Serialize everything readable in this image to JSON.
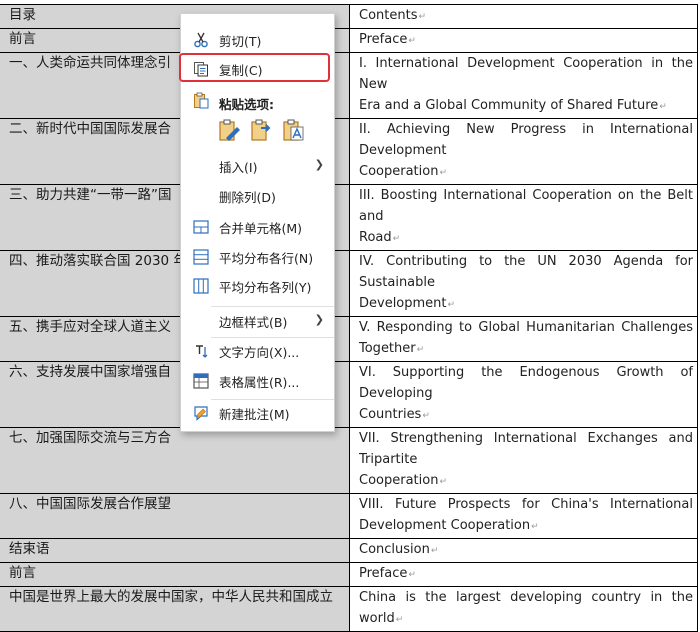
{
  "rows": [
    {
      "zh": "目录",
      "en": [
        "Contents"
      ]
    },
    {
      "zh": "前言",
      "en": [
        "Preface"
      ]
    },
    {
      "zh": "一、人类命运共同体理念引",
      "en": [
        "I. International Development Cooperation in the New",
        "Era and a Global Community of Shared Future"
      ]
    },
    {
      "zh": "二、新时代中国国际发展合",
      "en": [
        "II. Achieving New Progress in International Development",
        "Cooperation"
      ]
    },
    {
      "zh": "三、助力共建“一带一路”国",
      "en": [
        "III. Boosting International Cooperation on the Belt and",
        "Road"
      ]
    },
    {
      "zh": "四、推动落实联合国 2030 年",
      "en": [
        "IV. Contributing to the UN 2030 Agenda for Sustainable",
        "Development"
      ]
    },
    {
      "zh": "五、携手应对全球人道主义",
      "en": [
        "V. Responding to Global Humanitarian Challenges",
        "Together"
      ]
    },
    {
      "zh": "六、支持发展中国家增强自",
      "en": [
        "VI. Supporting the Endogenous Growth of Developing",
        "Countries"
      ]
    },
    {
      "zh": "七、加强国际交流与三方合",
      "en": [
        "VII. Strengthening International Exchanges and Tripartite",
        "Cooperation"
      ]
    },
    {
      "zh": "八、中国国际发展合作展望",
      "en": [
        "VIII. Future Prospects for China's International",
        "Development Cooperation"
      ]
    },
    {
      "zh": "结束语",
      "en": [
        "Conclusion"
      ]
    },
    {
      "zh": "前言",
      "en": [
        "Preface"
      ]
    },
    {
      "zh": "中国是世界上最大的发展中国家，中华人民共和国成立",
      "en": [
        "China is the largest developing country in the world"
      ]
    }
  ],
  "menu": {
    "cut": "剪切(T)",
    "copy": "复制(C)",
    "paste_options": "粘贴选项:",
    "insert": "插入(I)",
    "delete_column": "删除列(D)",
    "merge_cells": "合并单元格(M)",
    "distribute_rows": "平均分布各行(N)",
    "distribute_columns": "平均分布各列(Y)",
    "border_styles": "边框样式(B)",
    "text_direction": "文字方向(X)...",
    "table_properties": "表格属性(R)...",
    "new_comment": "新建批注(M)"
  },
  "colors": {
    "highlight": "#e0313a",
    "icon_blue": "#2e6fbd",
    "icon_orange": "#e8a033",
    "cell_gray": "#d4d4d4"
  }
}
